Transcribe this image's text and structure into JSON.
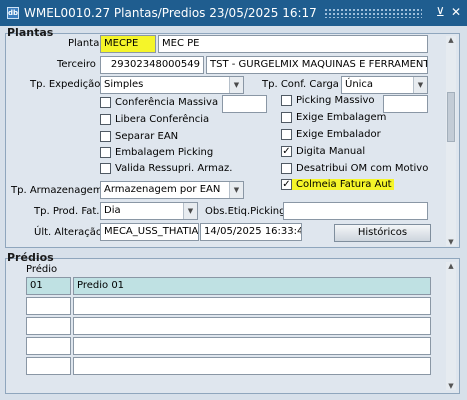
{
  "window": {
    "title": "WMEL0010.27     Plantas/Predios     23/05/2025 16:17",
    "minimize_glyph": "⊻",
    "close_glyph": "✕"
  },
  "plantas": {
    "section_title": "Plantas",
    "planta_label": "Planta",
    "planta_code": "MECPE",
    "planta_name": "MEC PE",
    "terceiro_label": "Terceiro",
    "terceiro_code": "29302348000549",
    "terceiro_name": "TST - GURGELMIX MAQUINAS E FERRAMENT",
    "tp_expedicao_label": "Tp. Expedição",
    "tp_expedicao_value": "Simples",
    "tp_conf_carga_label": "Tp. Conf. Carga",
    "tp_conf_carga_value": "Única",
    "checkboxes_left": [
      {
        "label": "Conferência Massiva",
        "checked": false
      },
      {
        "label": "Libera Conferência",
        "checked": false
      },
      {
        "label": "Separar EAN",
        "checked": false
      },
      {
        "label": "Embalagem Picking",
        "checked": false
      },
      {
        "label": "Valida Ressupri. Armaz.",
        "checked": false
      }
    ],
    "checkboxes_right": [
      {
        "label": "Picking Massivo",
        "checked": false
      },
      {
        "label": "Exige Embalagem",
        "checked": false
      },
      {
        "label": "Exige Embalador",
        "checked": false
      },
      {
        "label": "Digita Manual",
        "checked": true
      },
      {
        "label": "Desatribui OM com Motivo",
        "checked": false
      },
      {
        "label": "Colmeia Fatura Aut",
        "checked": true
      }
    ],
    "tp_armazenagem_label": "Tp. Armazenagem",
    "tp_armazenagem_value": "Armazenagem por EAN",
    "tp_prod_fat_label": "Tp. Prod. Fat.",
    "tp_prod_fat_value": "Dia",
    "obs_etiq_label": "Obs.Etiq.Picking",
    "obs_etiq_value": "",
    "ult_alteracao_label": "Últ. Alteração",
    "ult_alteracao_user": "MECA_USS_THATIA",
    "ult_alteracao_date": "14/05/2025 16:33:45",
    "historicos_button": "Históricos"
  },
  "predios": {
    "section_title": "Prédios",
    "column_header": "Prédio",
    "rows": [
      {
        "code": "01",
        "name": "Predio 01"
      },
      {
        "code": "",
        "name": ""
      },
      {
        "code": "",
        "name": ""
      },
      {
        "code": "",
        "name": ""
      },
      {
        "code": "",
        "name": ""
      }
    ]
  },
  "colors": {
    "titlebar": "#1f5d8f",
    "highlight": "#f5f529",
    "selected_row": "#bfe1e3"
  }
}
